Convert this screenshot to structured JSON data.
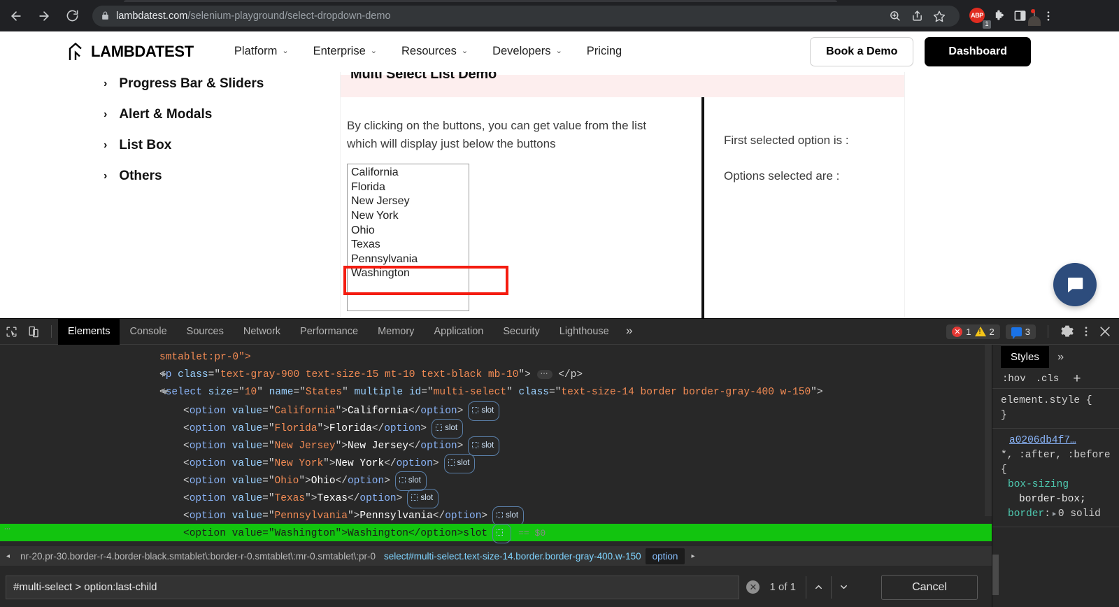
{
  "browser": {
    "url_domain": "lambdatest.com",
    "url_path": "/selenium-playground/select-dropdown-demo",
    "back_icon": "back-arrow-icon",
    "forward_icon": "forward-arrow-icon",
    "reload_icon": "reload-icon",
    "lock_icon": "lock-icon",
    "search_icon": "search-icon",
    "share_icon": "share-icon",
    "bookmark_icon": "star-icon",
    "adblock_label": "ABP",
    "adblock_badge": "1",
    "extensions_icon": "puzzle-piece-icon",
    "sidepanel_icon": "side-panel-icon",
    "profile_icon": "profile-avatar",
    "menu_icon": "kebab-menu-icon"
  },
  "site_header": {
    "brand": "LAMBDATEST",
    "nav": [
      {
        "label": "Platform",
        "caret": "⌄"
      },
      {
        "label": "Enterprise",
        "caret": "⌄"
      },
      {
        "label": "Resources",
        "caret": "⌄"
      },
      {
        "label": "Developers",
        "caret": "⌄"
      },
      {
        "label": "Pricing",
        "caret": ""
      }
    ],
    "book_demo": "Book a Demo",
    "dashboard": "Dashboard"
  },
  "sidebar": {
    "items": [
      {
        "label": "Progress Bar & Sliders",
        "chevron": "›"
      },
      {
        "label": "Alert & Modals",
        "chevron": "›"
      },
      {
        "label": "List Box",
        "chevron": "›"
      },
      {
        "label": "Others",
        "chevron": "›"
      }
    ]
  },
  "demo": {
    "title": "Multi Select List Demo",
    "description": "By clicking on the buttons, you can get value from the list which will display just below the buttons",
    "options": [
      "California",
      "Florida",
      "New Jersey",
      "New York",
      "Ohio",
      "Texas",
      "Pennsylvania",
      "Washington"
    ],
    "highlighted_option": "Washington",
    "highlight_color": "#f41c10",
    "first_selected_label": "First selected option is :",
    "options_selected_label": "Options selected are :",
    "chat_icon": "chat-bubble-icon"
  },
  "devtools": {
    "inspect_icon": "inspect-element-icon",
    "device_icon": "device-toolbar-icon",
    "tabs": [
      "Elements",
      "Console",
      "Sources",
      "Network",
      "Performance",
      "Memory",
      "Application",
      "Security",
      "Lighthouse"
    ],
    "active_tab": "Elements",
    "overflow_icon": "chevron-double-right-icon",
    "error_count": "1",
    "warning_count": "2",
    "message_count": "3",
    "settings_icon": "gear-icon",
    "more_icon": "kebab-menu-icon",
    "close_icon": "close-icon",
    "dom": {
      "line_parent_tail": "smtablet:pr-0\">",
      "p_tag": "p",
      "p_class_attr": "class",
      "p_class_value": "text-gray-900 text-size-15 mt-10 text-black mb-10",
      "p_ellipsis": "…",
      "p_close": "</p>",
      "select_tag": "select",
      "select_attrs": [
        {
          "name": "size",
          "value": "10"
        },
        {
          "name": "name",
          "value": "States"
        },
        {
          "name": "multiple",
          "value": null
        },
        {
          "name": "id",
          "value": "multi-select"
        },
        {
          "name": "class",
          "value": "text-size-14 border border-gray-400 w-150"
        }
      ],
      "options": [
        {
          "value": "California",
          "text": "California",
          "slot": "slot",
          "selected": false
        },
        {
          "value": "Florida",
          "text": "Florida",
          "slot": "slot",
          "selected": false
        },
        {
          "value": "New Jersey",
          "text": "New Jersey",
          "slot": "slot",
          "selected": false
        },
        {
          "value": "New York",
          "text": "New York",
          "slot": "slot",
          "selected": false
        },
        {
          "value": "Ohio",
          "text": "Ohio",
          "slot": "slot",
          "selected": false
        },
        {
          "value": "Texas",
          "text": "Texas",
          "slot": "slot",
          "selected": false
        },
        {
          "value": "Pennsylvania",
          "text": "Pennsylvania",
          "slot": "slot",
          "selected": false
        },
        {
          "value": "Washington",
          "text": "Washington",
          "slot": "slot",
          "selected": true
        }
      ],
      "selected_marker": "== $0",
      "overflow_dots": "…"
    },
    "breadcrumb": {
      "left_arrow": "◂",
      "right_arrow": "▸",
      "items": [
        "nr-20.pr-30.border-r-4.border-black.smtablet\\:border-r-0.smtablet\\:mr-0.smtablet\\:pr-0",
        "select#multi-select.text-size-14.border.border-gray-400.w-150",
        "option"
      ]
    },
    "search": {
      "value": "#multi-select > option:last-child",
      "clear_icon": "clear-icon",
      "match_count": "1 of 1",
      "prev_icon": "chevron-up-icon",
      "next_icon": "chevron-down-icon",
      "cancel_label": "Cancel"
    },
    "styles": {
      "tab_label": "Styles",
      "more_icon": "chevron-double-right-icon",
      "hov_label": ":hov",
      "cls_label": ".cls",
      "plus_label": "+",
      "element_style": "element.style {",
      "element_style_close": "}",
      "source_link": "a0206db4f7…",
      "rule_selector": "*, :after, :before {",
      "properties": [
        {
          "name": "box-sizing",
          "value": "border-box;"
        },
        {
          "name": "border",
          "value": "0 solid"
        }
      ]
    }
  }
}
